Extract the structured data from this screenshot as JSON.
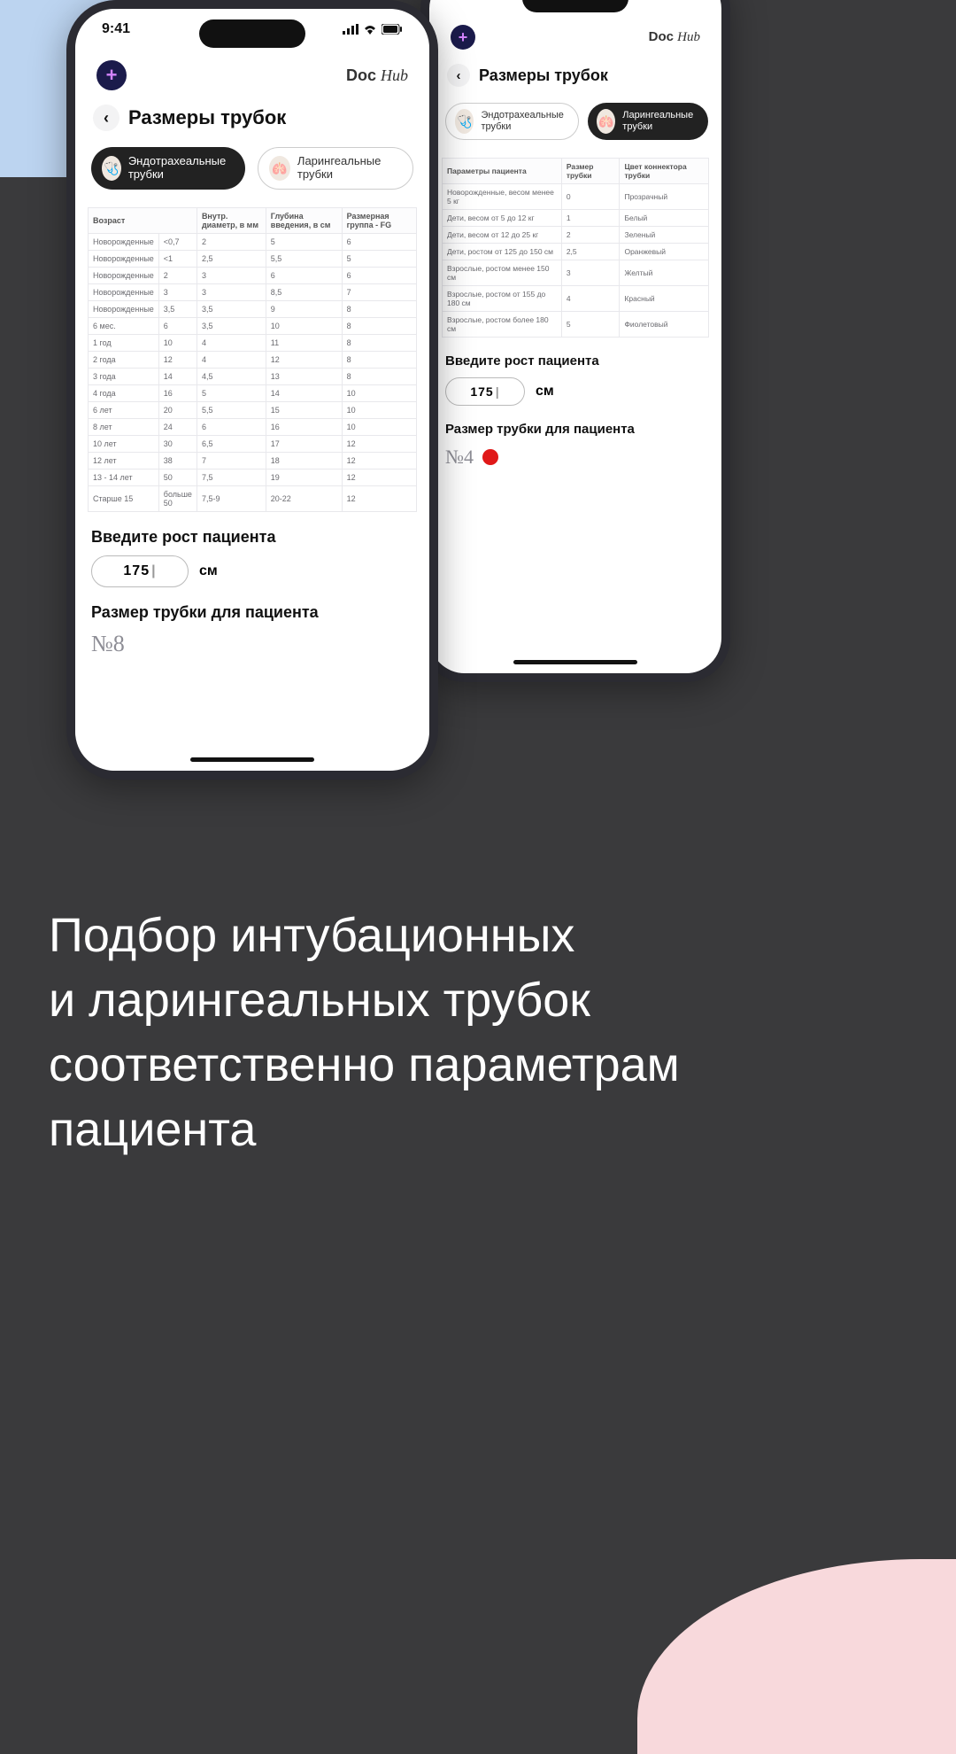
{
  "promo": "Подбор интубационных и ларингеальных трубок соответственно параметрам пациента",
  "status_time": "9:41",
  "brand_prefix": "Doc ",
  "brand_suffix": "Hub",
  "page_title": "Размеры трубок",
  "tabs": {
    "endo": "Эндотрахеальные трубки",
    "laryn": "Ларингеальные трубки"
  },
  "endo_table": {
    "h_age": "Возраст",
    "h_c2": "",
    "h_c3": "Внутр. диаметр, в мм",
    "h_c4": "Глубина введения, в см",
    "h_c5": "Размерная группа - FG",
    "rows": [
      [
        "Новорожденные",
        "<0,7",
        "2",
        "5",
        "6"
      ],
      [
        "Новорожденные",
        "<1",
        "2,5",
        "5,5",
        "5"
      ],
      [
        "Новорожденные",
        "2",
        "3",
        "6",
        "6"
      ],
      [
        "Новорожденные",
        "3",
        "3",
        "8,5",
        "7"
      ],
      [
        "Новорожденные",
        "3,5",
        "3,5",
        "9",
        "8"
      ],
      [
        "6 мес.",
        "6",
        "3,5",
        "10",
        "8"
      ],
      [
        "1 год",
        "10",
        "4",
        "11",
        "8"
      ],
      [
        "2 года",
        "12",
        "4",
        "12",
        "8"
      ],
      [
        "3 года",
        "14",
        "4,5",
        "13",
        "8"
      ],
      [
        "4 года",
        "16",
        "5",
        "14",
        "10"
      ],
      [
        "6 лет",
        "20",
        "5,5",
        "15",
        "10"
      ],
      [
        "8 лет",
        "24",
        "6",
        "16",
        "10"
      ],
      [
        "10 лет",
        "30",
        "6,5",
        "17",
        "12"
      ],
      [
        "12 лет",
        "38",
        "7",
        "18",
        "12"
      ],
      [
        "13 - 14 лет",
        "50",
        "7,5",
        "19",
        "12"
      ],
      [
        "Старше 15",
        "больше 50",
        "7,5-9",
        "20-22",
        "12"
      ]
    ]
  },
  "laryn_table": {
    "h1": "Параметры пациента",
    "h2": "Размер трубки",
    "h3": "Цвет коннектора трубки",
    "rows": [
      [
        "Новорожденные, весом менее 5 кг",
        "0",
        "Прозрачный"
      ],
      [
        "Дети, весом от 5 до 12 кг",
        "1",
        "Белый"
      ],
      [
        "Дети, весом от 12 до 25 кг",
        "2",
        "Зеленый"
      ],
      [
        "Дети, ростом от 125 до 150 см",
        "2,5",
        "Оранжевый"
      ],
      [
        "Взрослые, ростом менее 150 см",
        "3",
        "Желтый"
      ],
      [
        "Взрослые, ростом от 155 до 180 см",
        "4",
        "Красный"
      ],
      [
        "Взрослые, ростом более 180 см",
        "5",
        "Фиолетовый"
      ]
    ]
  },
  "enter_height_label": "Введите рост пациента",
  "height_value": "175",
  "height_unit": "см",
  "result_label": "Размер трубки для пациента",
  "result_front": "№8",
  "result_back": "№4",
  "colors": {
    "red": "#e01818"
  }
}
